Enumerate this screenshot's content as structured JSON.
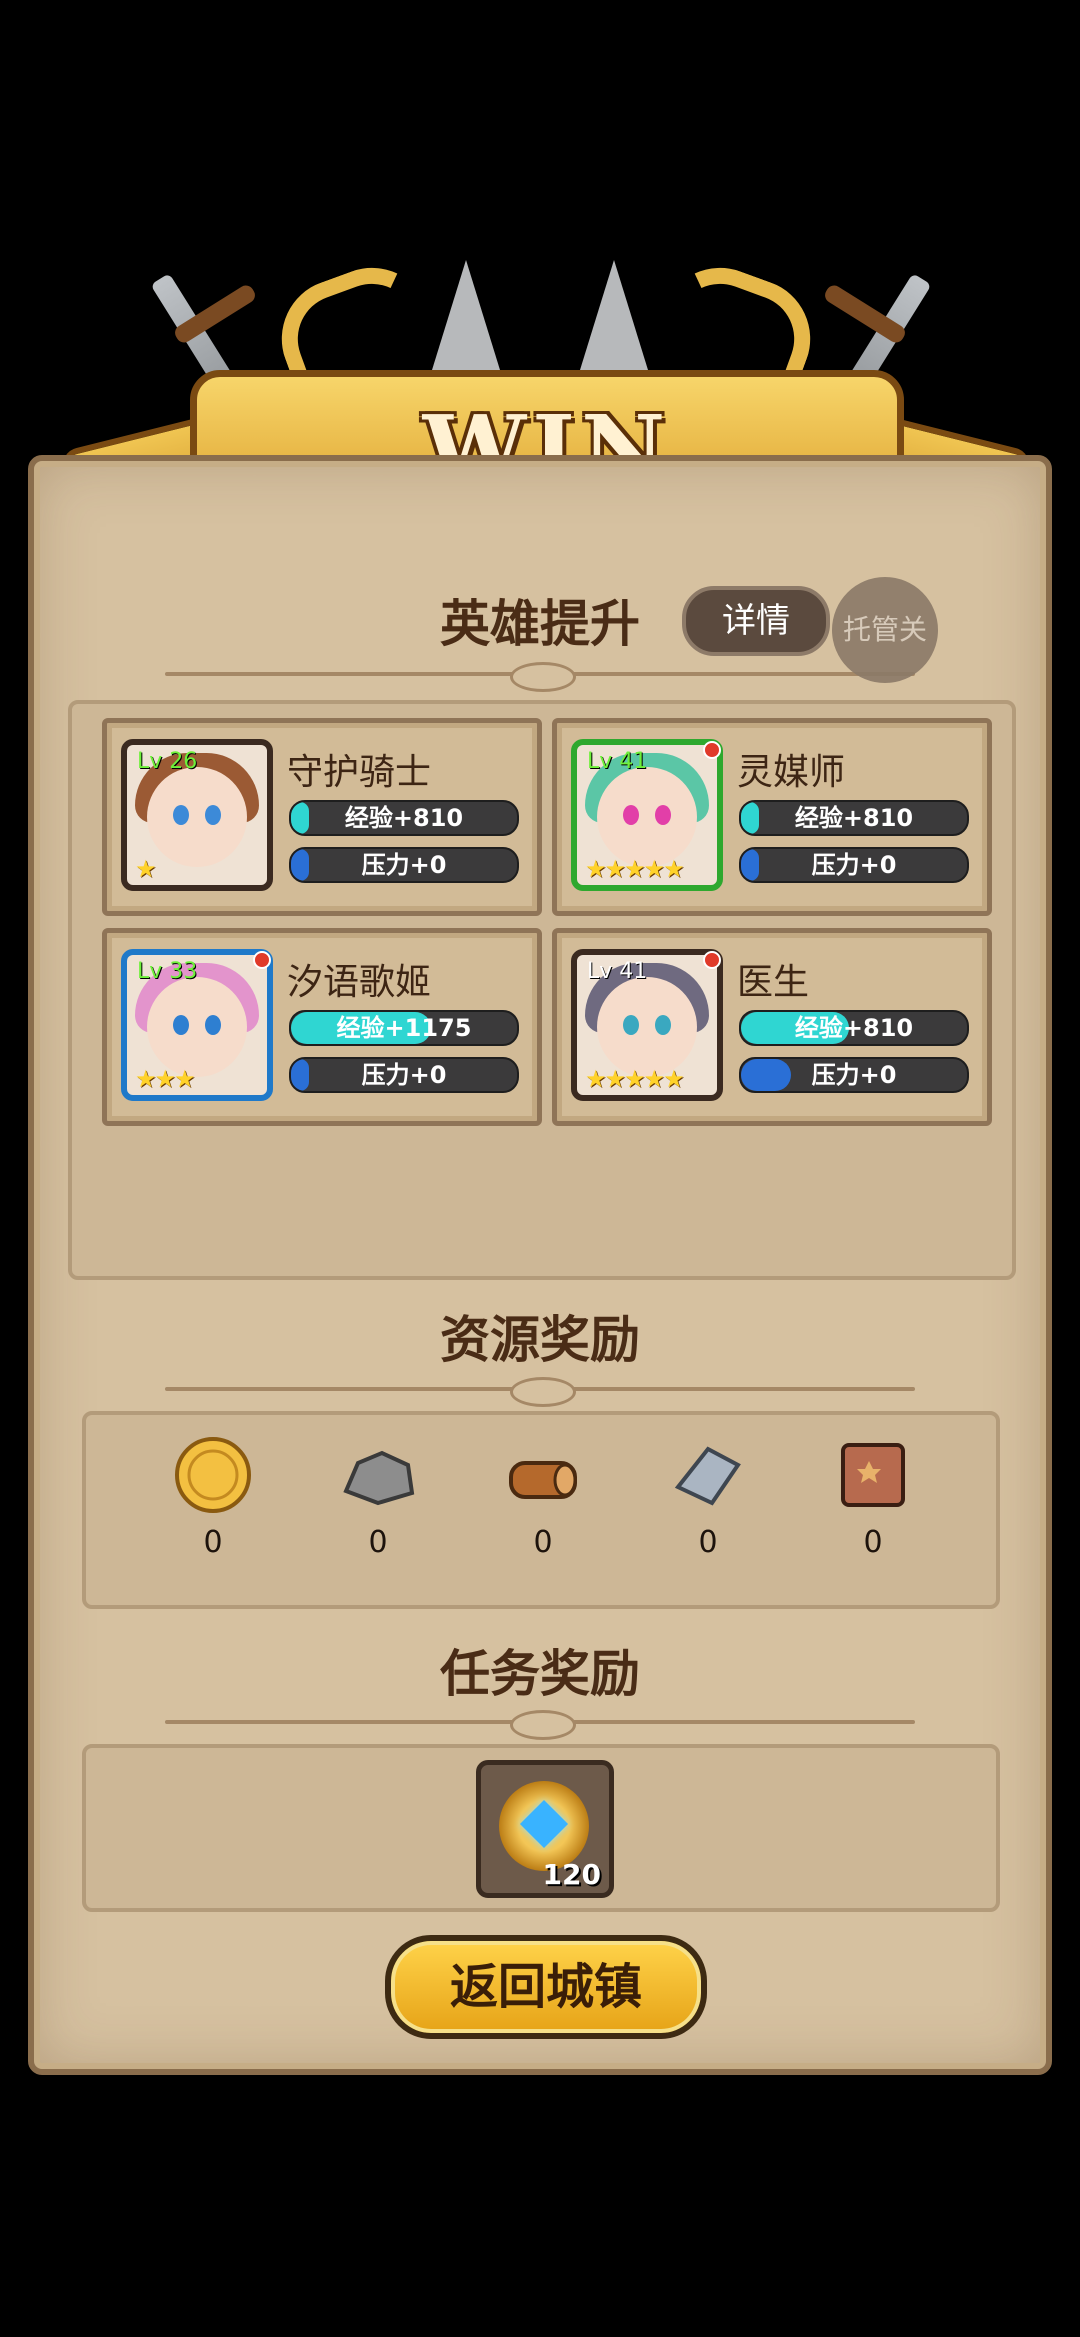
{
  "banner": {
    "title": "WIN"
  },
  "hero_section": {
    "title": "英雄提升",
    "details_label": "详情",
    "auto_label": "托管关"
  },
  "heroes": [
    {
      "name": "守护骑士",
      "level": "Lv 26",
      "stars": "★",
      "exp": "经验+810",
      "stress": "压力+0",
      "frame_color": "#3b2a20",
      "hair_color": "#9b5a34",
      "eye_color": "#3c8ad8",
      "alert": false
    },
    {
      "name": "灵媒师",
      "level": "Lv 41",
      "stars": "★★★★★",
      "exp": "经验+810",
      "stress": "压力+0",
      "frame_color": "#2ea82e",
      "hair_color": "#5bc6a6",
      "eye_color": "#e23fa8",
      "alert": true
    },
    {
      "name": "汐语歌姬",
      "level": "Lv 33",
      "stars": "★★★",
      "exp": "经验+1175",
      "stress": "压力+0",
      "frame_color": "#1f79c9",
      "hair_color": "#e394cc",
      "eye_color": "#2e7fd1",
      "alert": true
    },
    {
      "name": "医生",
      "level": "Lv 41",
      "stars": "★★★★★",
      "exp": "经验+810",
      "stress": "压力+0",
      "frame_color": "#3b2a20",
      "hair_color": "#6f6a80",
      "eye_color": "#3aa8c0",
      "alert": true
    }
  ],
  "resource_section": {
    "title": "资源奖励",
    "items": [
      {
        "icon": "gold-coin-icon",
        "value": "0"
      },
      {
        "icon": "stone-icon",
        "value": "0"
      },
      {
        "icon": "wood-log-icon",
        "value": "0"
      },
      {
        "icon": "iron-ingot-icon",
        "value": "0"
      },
      {
        "icon": "leather-icon",
        "value": "0"
      }
    ]
  },
  "task_section": {
    "title": "任务奖励",
    "item": {
      "icon": "medal-gem-icon",
      "count": "120"
    }
  },
  "return_button": {
    "label": "返回城镇"
  },
  "colors": {
    "exp_fill": "#2fd6d2",
    "stress_fill": "#2a6fd6",
    "gold": "#f3c041"
  }
}
